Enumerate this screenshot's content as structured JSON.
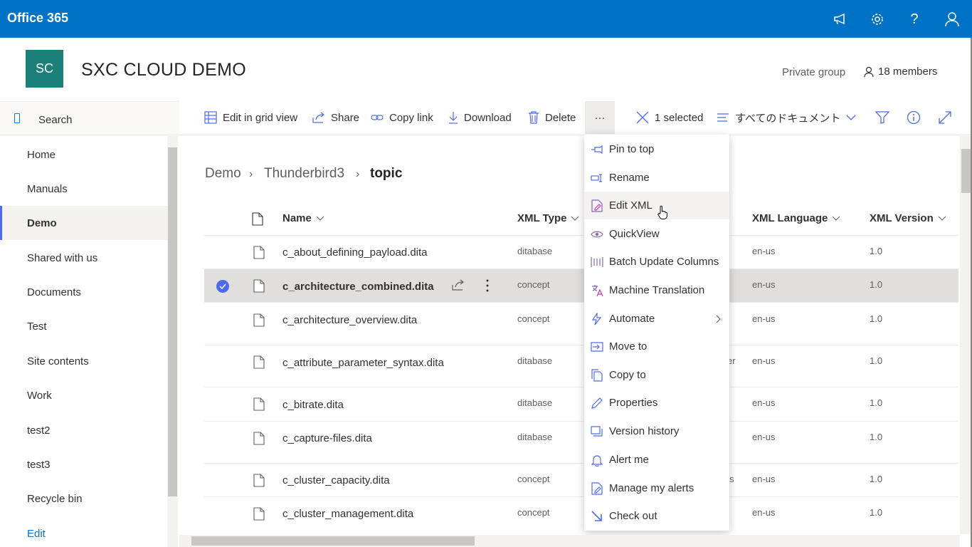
{
  "suite": {
    "brand": "Office 365"
  },
  "site": {
    "logo_text": "SC",
    "title": "SXC CLOUD DEMO",
    "privacy": "Private group",
    "members": "18 members"
  },
  "search": {
    "label": "Search"
  },
  "nav": {
    "items": [
      {
        "label": "Home"
      },
      {
        "label": "Manuals"
      },
      {
        "label": "Demo"
      },
      {
        "label": "Shared with us"
      },
      {
        "label": "Documents"
      },
      {
        "label": "Test"
      },
      {
        "label": "Site contents"
      },
      {
        "label": "Work"
      },
      {
        "label": "test2"
      },
      {
        "label": "test3"
      },
      {
        "label": "Recycle bin"
      },
      {
        "label": "Edit"
      }
    ]
  },
  "commands": {
    "edit_grid": "Edit in grid view",
    "share": "Share",
    "copy_link": "Copy link",
    "download": "Download",
    "delete": "Delete",
    "more": "···",
    "selected": "1 selected",
    "view": "すべてのドキュメント"
  },
  "breadcrumb": {
    "level1": "Demo",
    "level2": "Thunderbird3",
    "current": "topic"
  },
  "columns": {
    "name": "Name",
    "xml_type": "XML Type",
    "xml_language": "XML Language",
    "xml_version": "XML Version"
  },
  "rows": [
    {
      "name": "c_about_defining_payload.dita",
      "type": "ditabase",
      "extra": "",
      "lang": "en-us",
      "version": "1.0"
    },
    {
      "name": "c_architecture_combined.dita",
      "type": "concept",
      "extra": "",
      "lang": "en-us",
      "version": "1.0"
    },
    {
      "name": "c_architecture_overview.dita",
      "type": "concept",
      "extra": "",
      "lang": "en-us",
      "version": "1.0"
    },
    {
      "name": "c_attribute_parameter_syntax.dita",
      "type": "ditabase",
      "extra": "er",
      "lang": "en-us",
      "version": "1.0"
    },
    {
      "name": "c_bitrate.dita",
      "type": "ditabase",
      "extra": "",
      "lang": "en-us",
      "version": "1.0"
    },
    {
      "name": "c_capture-files.dita",
      "type": "ditabase",
      "extra": "",
      "lang": "en-us",
      "version": "1.0"
    },
    {
      "name": "c_cluster_capacity.dita",
      "type": "concept",
      "extra": "s",
      "lang": "en-us",
      "version": "1.0"
    },
    {
      "name": "c_cluster_management.dita",
      "type": "concept",
      "extra": "",
      "lang": "en-us",
      "version": "1.0"
    }
  ],
  "menu": {
    "items": [
      {
        "label": "Pin to top",
        "icon": "pin-icon"
      },
      {
        "label": "Rename",
        "icon": "rename-icon"
      },
      {
        "label": "Edit XML",
        "icon": "edit-xml-icon"
      },
      {
        "label": "QuickView",
        "icon": "eye-icon"
      },
      {
        "label": "Batch Update Columns",
        "icon": "batch-update-icon"
      },
      {
        "label": "Machine Translation",
        "icon": "translate-icon"
      },
      {
        "label": "Automate",
        "icon": "automate-icon"
      },
      {
        "label": "Move to",
        "icon": "move-icon"
      },
      {
        "label": "Copy to",
        "icon": "copy-icon"
      },
      {
        "label": "Properties",
        "icon": "pencil-icon"
      },
      {
        "label": "Version history",
        "icon": "version-history-icon"
      },
      {
        "label": "Alert me",
        "icon": "bell-icon"
      },
      {
        "label": "Manage my alerts",
        "icon": "manage-alerts-icon"
      },
      {
        "label": "Check out",
        "icon": "check-out-icon"
      }
    ]
  },
  "colors": {
    "suite_bar": "#0072c6",
    "accent": "#4f6bed",
    "logo": "#1d7f7a",
    "purple_icon": "#8764b8"
  }
}
